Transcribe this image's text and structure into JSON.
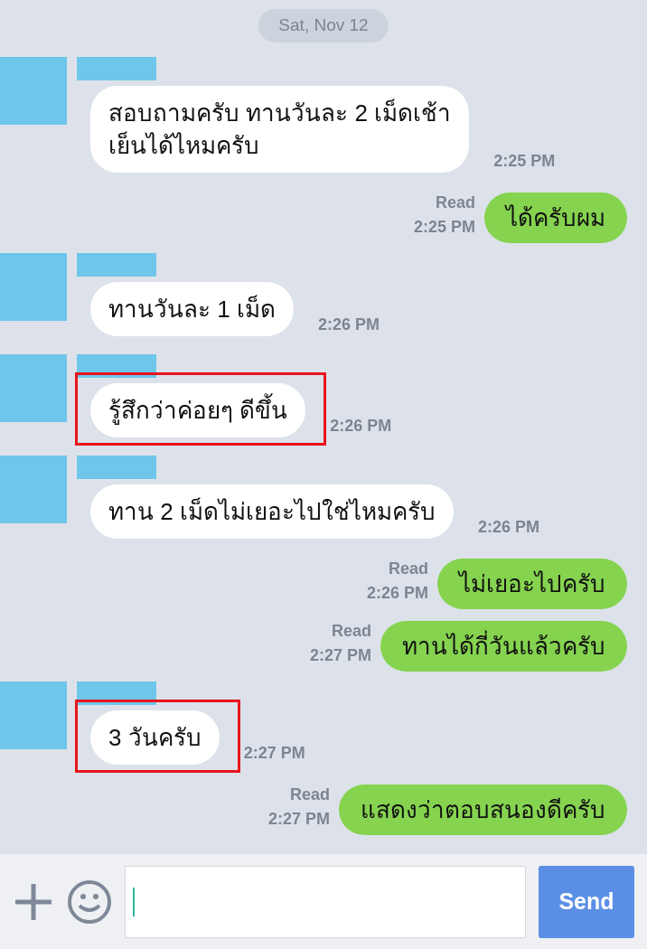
{
  "date": "Sat, Nov 12",
  "messages": [
    {
      "kind": "in",
      "text": "สอบถามครับ ทานวันละ 2 เม็ดเช้า\nเย็นได้ไหมครับ",
      "time": "2:25 PM",
      "highlighted": false
    },
    {
      "kind": "out",
      "text": "ได้ครับผม",
      "read": "Read",
      "time": "2:25 PM"
    },
    {
      "kind": "in",
      "text": "ทานวันละ 1 เม็ด",
      "time": "2:26 PM",
      "highlighted": false
    },
    {
      "kind": "in",
      "text": "รู้สึกว่าค่อยๆ ดีขึ้น",
      "time": "2:26 PM",
      "highlighted": true
    },
    {
      "kind": "in",
      "text": "ทาน 2 เม็ดไม่เยอะไปใช่ไหมครับ",
      "time": "2:26 PM",
      "highlighted": false
    },
    {
      "kind": "out",
      "text": "ไม่เยอะไปครับ",
      "read": "Read",
      "time": "2:26 PM"
    },
    {
      "kind": "out",
      "text": "ทานได้กี่วันแล้วครับ",
      "read": "Read",
      "time": "2:27 PM"
    },
    {
      "kind": "in",
      "text": "3 วันครับ",
      "time": "2:27 PM",
      "highlighted": true
    },
    {
      "kind": "out",
      "text": "แสดงว่าตอบสนองดีครับ",
      "read": "Read",
      "time": "2:27 PM"
    }
  ],
  "composer": {
    "send": "Send"
  }
}
